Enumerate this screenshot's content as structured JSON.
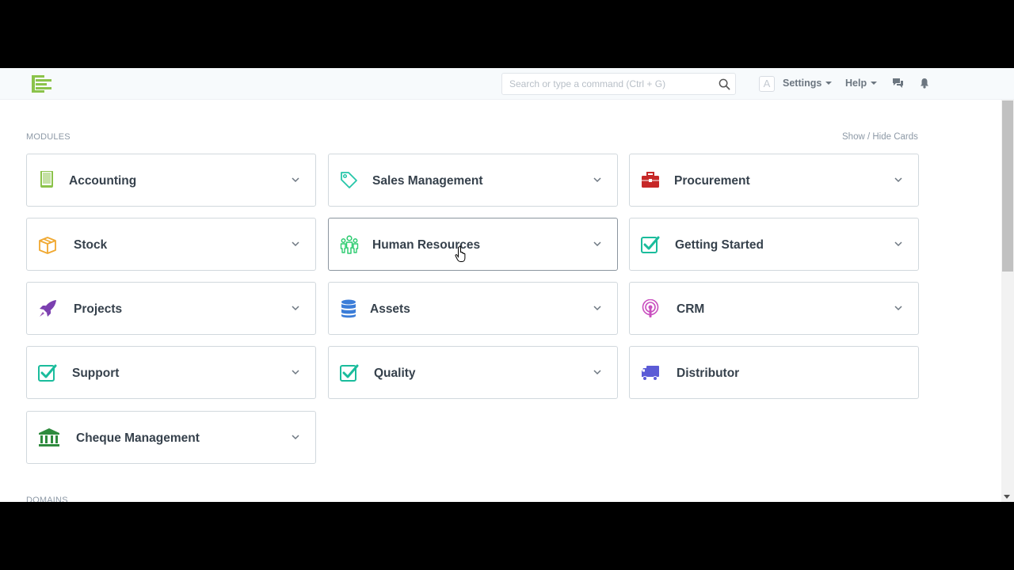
{
  "navbar": {
    "search": {
      "placeholder": "Search or type a command (Ctrl + G)"
    },
    "avatar_letter": "A",
    "settings_label": "Settings",
    "help_label": "Help"
  },
  "modules_label": "MODULES",
  "show_hide_label": "Show / Hide Cards",
  "domains_label": "DOMAINS",
  "modules": [
    {
      "label": "Accounting",
      "icon": "book-icon",
      "color": "#8bc34a",
      "has_dropdown": true
    },
    {
      "label": "Sales Management",
      "icon": "tag-icon",
      "color": "#26c6a9",
      "has_dropdown": true
    },
    {
      "label": "Procurement",
      "icon": "briefcase-icon",
      "color": "#c62828",
      "has_dropdown": true
    },
    {
      "label": "Stock",
      "icon": "box-icon",
      "color": "#f0a830",
      "has_dropdown": true
    },
    {
      "label": "Human Resources",
      "icon": "people-icon",
      "color": "#2ecc71",
      "has_dropdown": true,
      "hovered": true
    },
    {
      "label": "Getting Started",
      "icon": "checkbox-icon",
      "color": "#1abc9c",
      "has_dropdown": true
    },
    {
      "label": "Projects",
      "icon": "rocket-icon",
      "color": "#7b3fb0",
      "has_dropdown": true
    },
    {
      "label": "Assets",
      "icon": "database-icon",
      "color": "#3b7dd8",
      "has_dropdown": true
    },
    {
      "label": "CRM",
      "icon": "broadcast-icon",
      "color": "#c94fbf",
      "has_dropdown": true
    },
    {
      "label": "Support",
      "icon": "checkbox-icon",
      "color": "#1abc9c",
      "has_dropdown": true
    },
    {
      "label": "Quality",
      "icon": "checkbox-icon",
      "color": "#1abc9c",
      "has_dropdown": true
    },
    {
      "label": "Distributor",
      "icon": "truck-icon",
      "color": "#5b5bd6",
      "has_dropdown": false
    },
    {
      "label": "Cheque Management",
      "icon": "bank-icon",
      "color": "#2e8b3e",
      "has_dropdown": true
    }
  ]
}
